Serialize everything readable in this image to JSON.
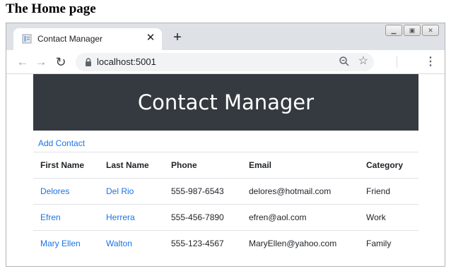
{
  "caption": "The Home page",
  "browser": {
    "tab_title": "Contact Manager",
    "url": "localhost:5001"
  },
  "page": {
    "heading": "Contact Manager",
    "add_link": "Add Contact",
    "columns": [
      "First Name",
      "Last Name",
      "Phone",
      "Email",
      "Category"
    ],
    "rows": [
      {
        "first": "Delores",
        "last": "Del Rio",
        "phone": "555-987-6543",
        "email": "delores@hotmail.com",
        "category": "Friend"
      },
      {
        "first": "Efren",
        "last": "Herrera",
        "phone": "555-456-7890",
        "email": "efren@aol.com",
        "category": "Work"
      },
      {
        "first": "Mary Ellen",
        "last": "Walton",
        "phone": "555-123-4567",
        "email": "MaryEllen@yahoo.com",
        "category": "Family"
      }
    ]
  },
  "colors": {
    "jumbotron": "#343a40",
    "link": "#1a73e8",
    "tabstrip": "#dee1e6"
  },
  "icons": [
    "page-favicon-icon",
    "close-icon",
    "plus-icon",
    "back-arrow-icon",
    "forward-arrow-icon",
    "reload-icon",
    "lock-icon",
    "zoom-icon",
    "star-icon",
    "kebab-menu-icon",
    "minimize-icon",
    "restore-icon",
    "window-close-icon"
  ]
}
